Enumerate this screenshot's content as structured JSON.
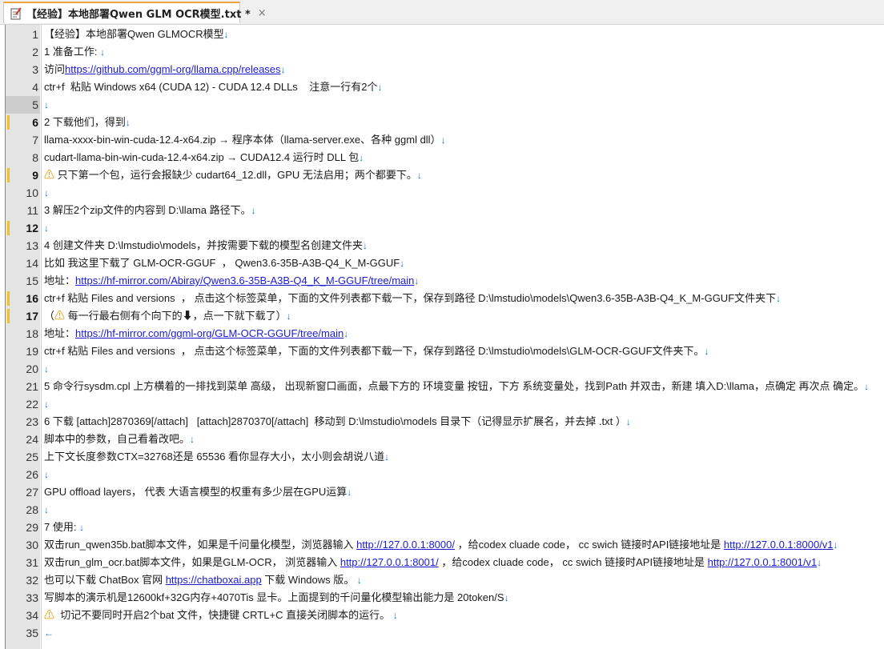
{
  "tab": {
    "title": "【经验】本地部署Qwen GLM OCR模型.txt *",
    "close": "×"
  },
  "eol": "↓",
  "eof": "←",
  "lines": [
    {
      "n": "1",
      "parts": [
        {
          "t": "【经验】本地部署Qwen GLMOCR模型"
        }
      ]
    },
    {
      "n": "2",
      "parts": [
        {
          "t": "1 准备工作: "
        }
      ]
    },
    {
      "n": "3",
      "parts": [
        {
          "t": "访问"
        },
        {
          "t": "https://github.com/ggml-org/llama.cpp/releases",
          "link": true
        }
      ]
    },
    {
      "n": "4",
      "parts": [
        {
          "t": "ctr+f  粘贴 Windows x64 (CUDA 12) - CUDA 12.4 DLLs    注意一行有2个"
        }
      ]
    },
    {
      "n": "5",
      "parts": [],
      "current": true
    },
    {
      "n": "6",
      "parts": [
        {
          "t": "2 下载他们，得到"
        }
      ],
      "mark": true,
      "bold": true
    },
    {
      "n": "7",
      "parts": [
        {
          "t": "llama-xxxx-bin-win-cuda-12.4-x64.zip → 程序本体（llama-server.exe、各种 ggml dll）"
        }
      ]
    },
    {
      "n": "8",
      "parts": [
        {
          "t": "cudart-llama-bin-win-cuda-12.4-x64.zip → CUDA12.4 运行时 DLL 包"
        }
      ]
    },
    {
      "n": "9",
      "parts": [
        {
          "t": "⚠",
          "warn": true
        },
        {
          "t": " 只下第一个包，运行会报缺少 cudart64_12.dll，GPU 无法启用；两个都要下。"
        }
      ],
      "mark": true,
      "bold": true
    },
    {
      "n": "10",
      "parts": []
    },
    {
      "n": "11",
      "parts": [
        {
          "t": "3 解压2个zip文件的内容到 D:\\llama 路径下。"
        }
      ]
    },
    {
      "n": "12",
      "parts": [],
      "mark": true,
      "bold": true
    },
    {
      "n": "13",
      "parts": [
        {
          "t": "4 创建文件夹 D:\\lmstudio\\models，并按需要下载的模型名创建文件夹"
        }
      ]
    },
    {
      "n": "14",
      "parts": [
        {
          "t": "比如 我这里下载了 GLM-OCR-GGUF  ， Qwen3.6-35B-A3B-Q4_K_M-GGUF"
        }
      ]
    },
    {
      "n": "15",
      "parts": [
        {
          "t": "地址："
        },
        {
          "t": "https://hf-mirror.com/Abiray/Qwen3.6-35B-A3B-Q4_K_M-GGUF/tree/main",
          "link": true
        }
      ]
    },
    {
      "n": "16",
      "parts": [
        {
          "t": "ctr+f 粘贴 Files and versions  ， 点击这个标签菜单，下面的文件列表都下载一下，保存到路径 D:\\lmstudio\\models\\Qwen3.6-35B-A3B-Q4_K_M-GGUF文件夹下"
        }
      ],
      "mark": true,
      "bold": true
    },
    {
      "n": "17",
      "parts": [
        {
          "t": "（"
        },
        {
          "t": "⚠",
          "warn": true
        },
        {
          "t": " 每一行最右侧有个向下的⬇，点一下就下载了）"
        }
      ],
      "mark": true,
      "bold": true
    },
    {
      "n": "18",
      "parts": [
        {
          "t": "地址："
        },
        {
          "t": "https://hf-mirror.com/ggml-org/GLM-OCR-GGUF/tree/main",
          "link": true
        }
      ]
    },
    {
      "n": "19",
      "parts": [
        {
          "t": "ctr+f 粘贴 Files and versions  ， 点击这个标签菜单，下面的文件列表都下载一下，保存到路径 D:\\lmstudio\\models\\GLM-OCR-GGUF文件夹下。"
        }
      ]
    },
    {
      "n": "20",
      "parts": []
    },
    {
      "n": "21",
      "parts": [
        {
          "t": "5 命令行sysdm.cpl 上方横着的一排找到菜单 高级， 出现新窗口画面，点最下方的 环境变量 按钮，下方 系统变量处，找到Path 并双击，新建 填入D:\\llama，点确定 再次点 确定。"
        }
      ]
    },
    {
      "n": "22",
      "parts": []
    },
    {
      "n": "23",
      "parts": [
        {
          "t": "6 下载 [attach]2870369[/attach]   [attach]2870370[/attach]  移动到 D:\\lmstudio\\models 目录下（记得显示扩展名，并去掉 .txt ）"
        }
      ]
    },
    {
      "n": "24",
      "parts": [
        {
          "t": "脚本中的参数，自己看着改吧。"
        }
      ]
    },
    {
      "n": "25",
      "parts": [
        {
          "t": "上下文长度参数CTX=32768还是 65536 看你显存大小，太小则会胡说八道"
        }
      ]
    },
    {
      "n": "26",
      "parts": []
    },
    {
      "n": "27",
      "parts": [
        {
          "t": "GPU offload layers， 代表 大语言模型的权重有多少层在GPU运算"
        }
      ]
    },
    {
      "n": "28",
      "parts": []
    },
    {
      "n": "29",
      "parts": [
        {
          "t": "7 使用: "
        }
      ]
    },
    {
      "n": "30",
      "parts": [
        {
          "t": "双击run_qwen35b.bat脚本文件，如果是千问量化模型，浏览器输入 "
        },
        {
          "t": "http://127.0.0.1:8000/",
          "link": true
        },
        {
          "t": " ，给codex cluade code， cc swich 链接时API链接地址是 "
        },
        {
          "t": "http://127.0.0.1:8000/v1",
          "link": true
        }
      ]
    },
    {
      "n": "31",
      "parts": [
        {
          "t": "双击run_glm_ocr.bat脚本文件，如果是GLM-OCR， 浏览器输入 "
        },
        {
          "t": "http://127.0.0.1:8001/",
          "link": true
        },
        {
          "t": " ，给codex cluade code， cc swich 链接时API链接地址是 "
        },
        {
          "t": "http://127.0.0.1:8001/v1",
          "link": true
        }
      ]
    },
    {
      "n": "32",
      "parts": [
        {
          "t": "也可以下载 ChatBox 官网 "
        },
        {
          "t": "https://chatboxai.app",
          "link": true
        },
        {
          "t": " 下载 Windows 版。 "
        }
      ]
    },
    {
      "n": "33",
      "parts": [
        {
          "t": "写脚本的演示机是12600kf+32G内存+4070Tis 显卡。上面提到的千问量化模型输出能力是 20token/S"
        }
      ]
    },
    {
      "n": "34",
      "parts": [
        {
          "t": "⚠",
          "warn": true
        },
        {
          "t": "  切记不要同时开启2个bat 文件，快捷键 CRTL+C 直接关闭脚本的运行。 "
        }
      ]
    },
    {
      "n": "35",
      "parts": [],
      "eof": true
    }
  ]
}
